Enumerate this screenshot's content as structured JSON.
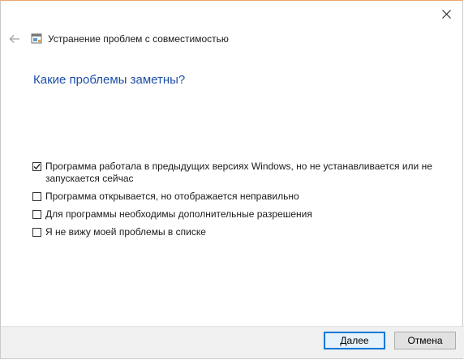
{
  "window": {
    "close_icon": "close-icon"
  },
  "nav": {
    "back_icon": "back-arrow-icon",
    "app_icon": "troubleshooter-icon",
    "title": "Устранение проблем с совместимостью"
  },
  "heading": "Какие проблемы заметны?",
  "options": [
    {
      "label": "Программа работала в предыдущих версиях Windows, но не устанавливается или не запускается сейчас",
      "checked": true
    },
    {
      "label": "Программа открывается, но отображается неправильно",
      "checked": false
    },
    {
      "label": "Для программы необходимы дополнительные разрешения",
      "checked": false
    },
    {
      "label": "Я не вижу моей проблемы в списке",
      "checked": false
    }
  ],
  "footer": {
    "next_label": "Далее",
    "cancel_label": "Отмена"
  },
  "colors": {
    "accent": "#0078d7",
    "heading": "#1c4fa8"
  }
}
